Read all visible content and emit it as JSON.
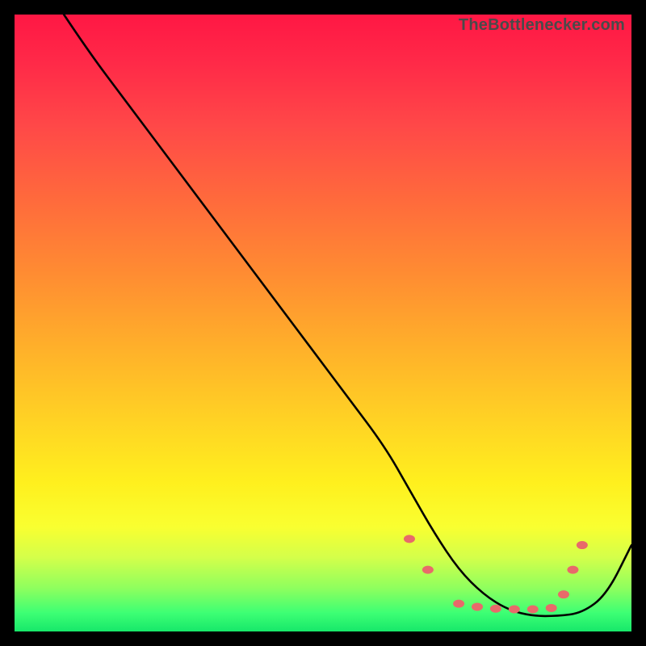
{
  "watermark": "TheBottlenecker.com",
  "chart_data": {
    "type": "line",
    "title": "",
    "xlabel": "",
    "ylabel": "",
    "xlim": [
      0,
      100
    ],
    "ylim": [
      0,
      100
    ],
    "series": [
      {
        "name": "curve",
        "x": [
          8,
          12,
          18,
          24,
          30,
          36,
          42,
          48,
          54,
          60,
          64,
          68,
          72,
          76,
          80,
          84,
          88,
          92,
          96,
          100
        ],
        "y": [
          100,
          94,
          86,
          78,
          70,
          62,
          54,
          46,
          38,
          30,
          23,
          16,
          10,
          6,
          3.5,
          2.5,
          2.5,
          3,
          6,
          14
        ]
      }
    ],
    "markers": {
      "name": "markers",
      "x": [
        64,
        67,
        72,
        75,
        78,
        81,
        84,
        87,
        89,
        90.5,
        92
      ],
      "y": [
        15,
        10,
        4.5,
        4,
        3.7,
        3.6,
        3.6,
        3.8,
        6,
        10,
        14
      ]
    },
    "marker_style": {
      "fill": "#e86a6a",
      "rx": 7,
      "ry": 5
    },
    "line_style": {
      "stroke": "#000000",
      "width": 2.6
    }
  }
}
